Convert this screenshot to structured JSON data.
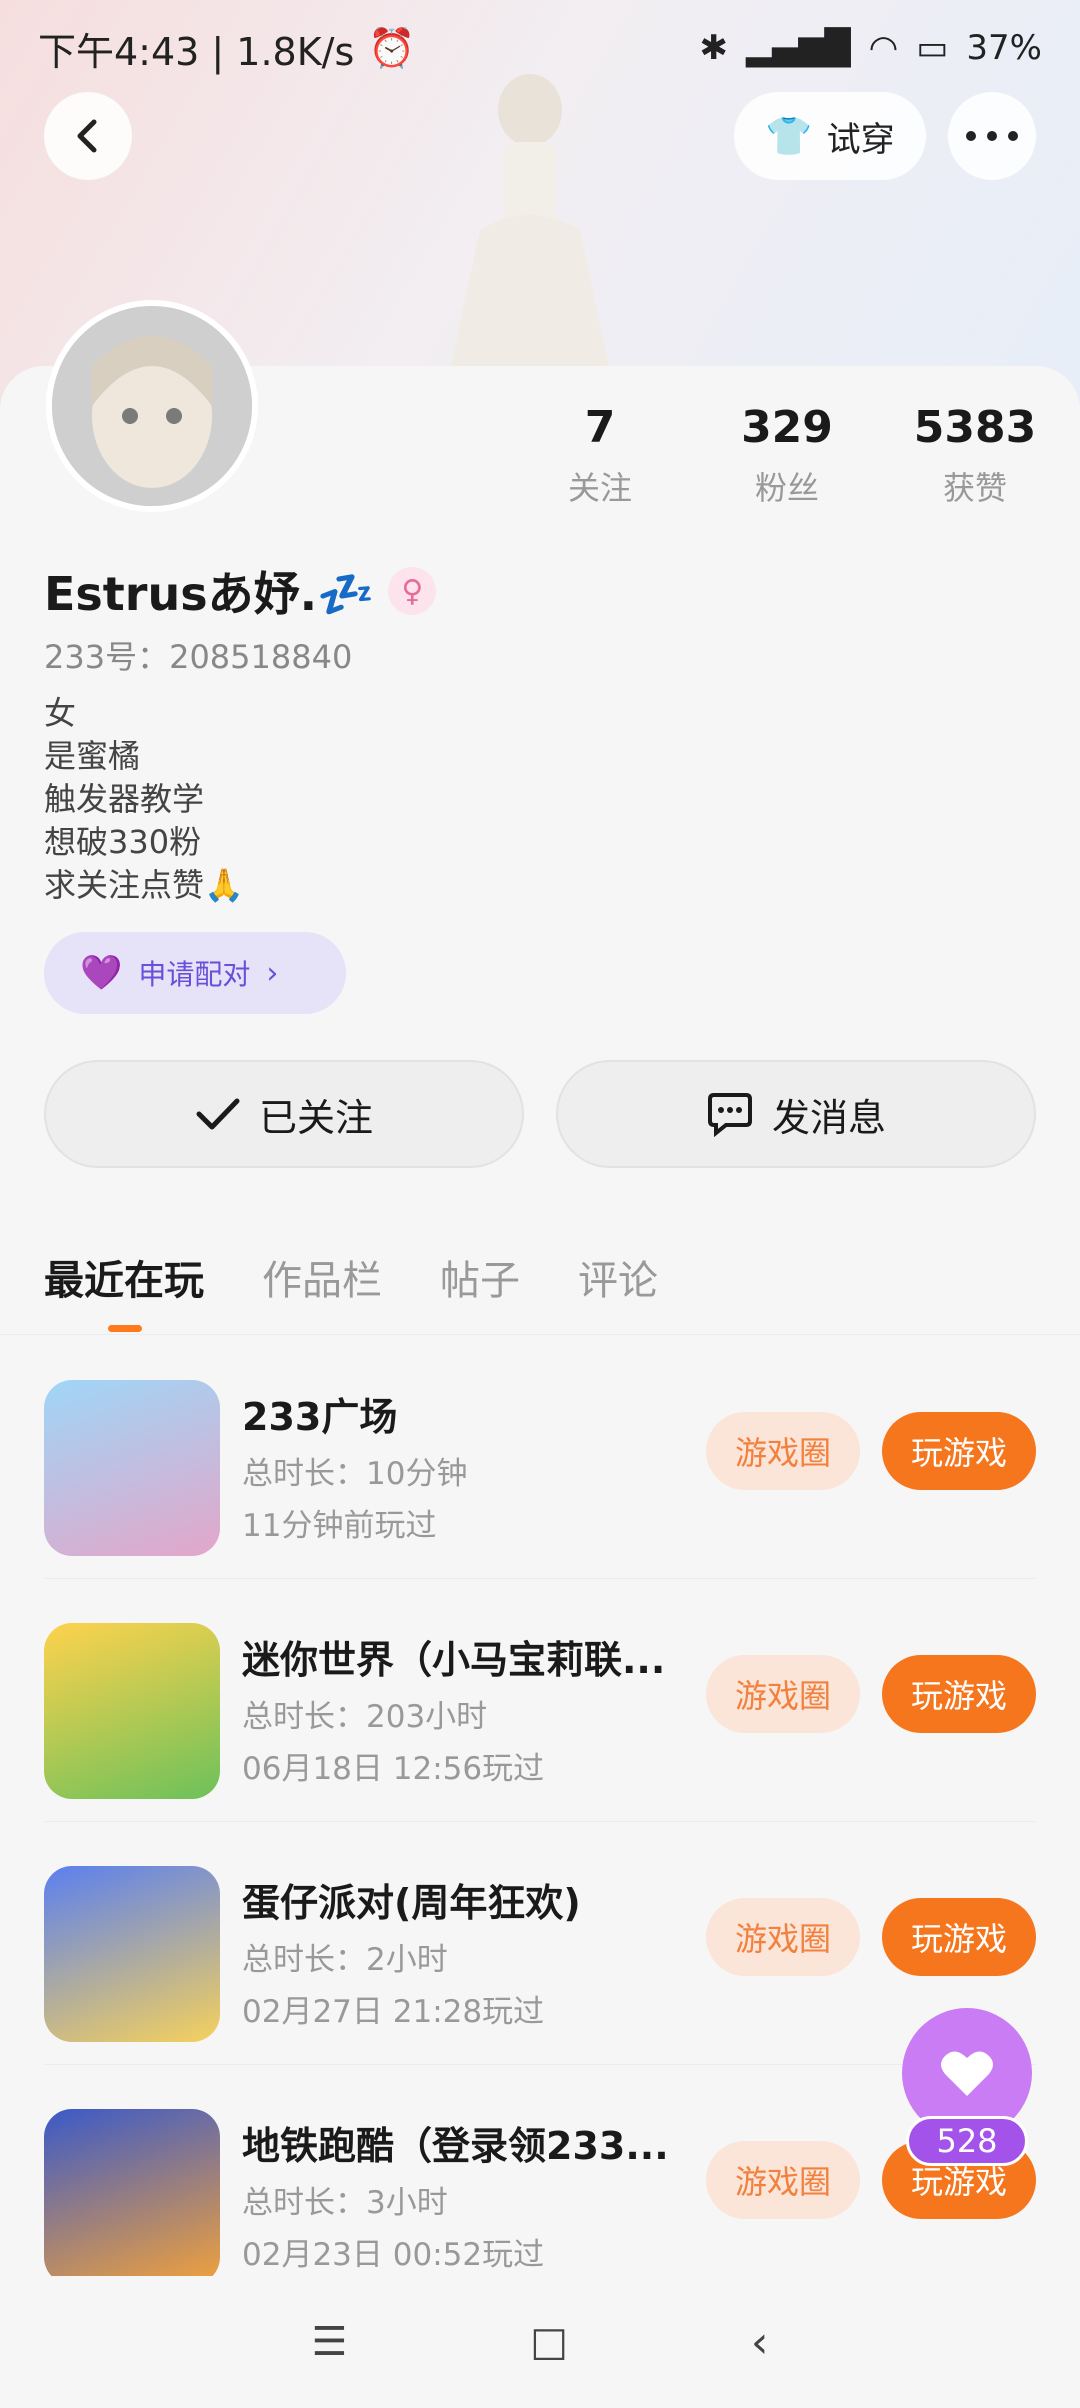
{
  "status_bar": {
    "time_speed": "下午4:43 | 1.8K/s",
    "battery": "37%"
  },
  "header": {
    "try_on_label": "试穿"
  },
  "profile": {
    "stats": [
      {
        "num": "7",
        "label": "关注"
      },
      {
        "num": "329",
        "label": "粉丝"
      },
      {
        "num": "5383",
        "label": "获赞"
      }
    ],
    "name": "Estrusあ妤.💤",
    "uid": "233号：208518840",
    "bio": [
      "女",
      "是蜜橘",
      "触发器教学",
      "想破330粉",
      "求关注点赞🙏"
    ],
    "pair_label": "申请配对",
    "follow_label": "已关注",
    "message_label": "发消息"
  },
  "tabs": [
    "最近在玩",
    "作品栏",
    "帖子",
    "评论"
  ],
  "games": [
    {
      "title": "233广场",
      "duration": "总时长：10分钟",
      "last": "11分钟前玩过",
      "circle": "游戏圈",
      "play": "玩游戏",
      "color": "#7cc3f2"
    },
    {
      "title": "迷你世界（小马宝莉联...",
      "duration": "总时长：203小时",
      "last": "06月18日 12:56玩过",
      "circle": "游戏圈",
      "play": "玩游戏",
      "color": "#74c86b"
    },
    {
      "title": "蛋仔派对(周年狂欢)",
      "duration": "总时长：2小时",
      "last": "02月27日 21:28玩过",
      "circle": "游戏圈",
      "play": "玩游戏",
      "color": "#6f8cf0"
    },
    {
      "title": "地铁跑酷（登录领233...",
      "duration": "总时长：3小时",
      "last": "02月23日 00:52玩过",
      "circle": "游戏圈",
      "play": "玩游戏",
      "color": "#4b6fd8"
    }
  ],
  "fab": {
    "count": "528"
  }
}
